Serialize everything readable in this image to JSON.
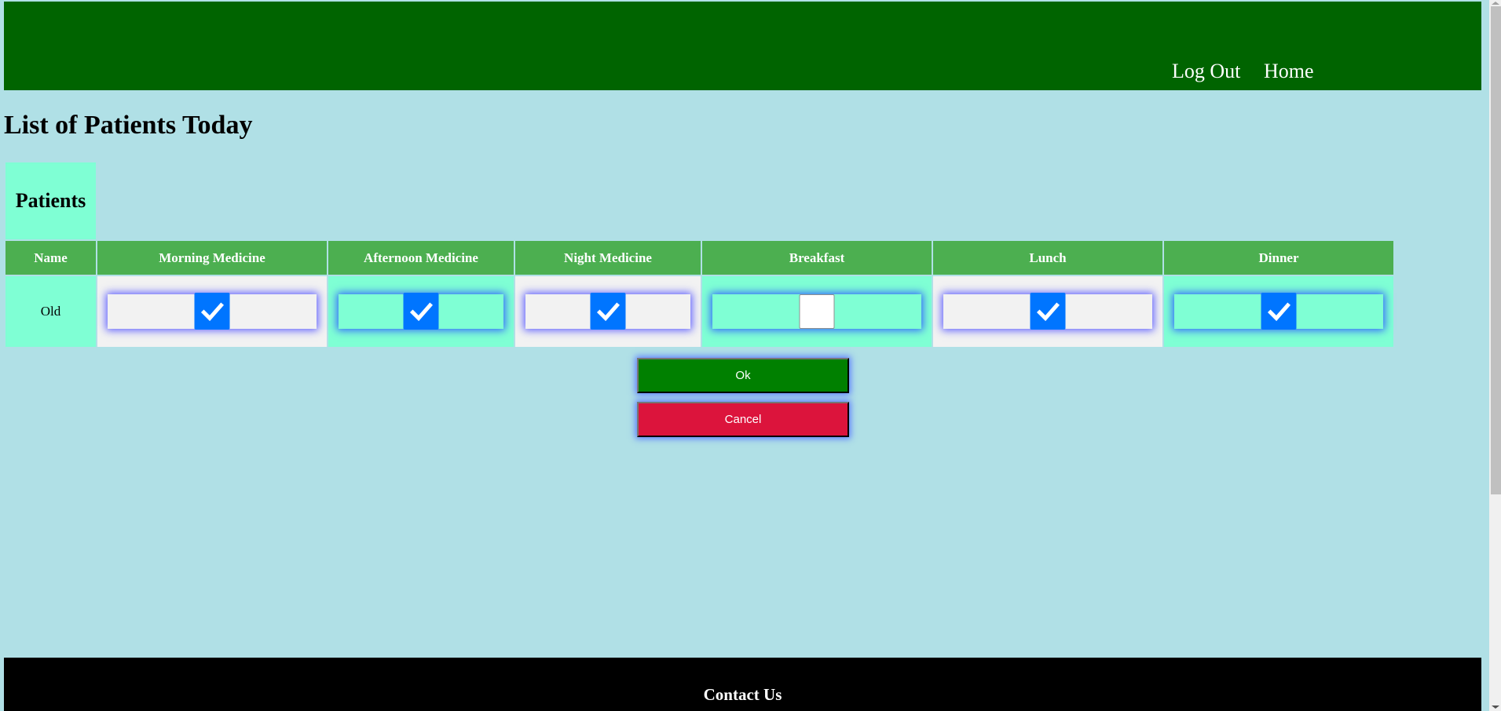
{
  "header": {
    "nav": [
      {
        "label": "Log Out"
      },
      {
        "label": "Home"
      }
    ]
  },
  "page_title": "List of Patients Today",
  "table": {
    "caption": "Patients",
    "columns": [
      "Name",
      "Morning Medicine",
      "Afternoon Medicine",
      "Night Medicine",
      "Breakfast",
      "Lunch",
      "Dinner"
    ],
    "rows": [
      {
        "name": "Old",
        "checks": [
          true,
          true,
          true,
          false,
          true,
          true
        ]
      }
    ]
  },
  "buttons": {
    "ok": "Ok",
    "cancel": "Cancel"
  },
  "footer": {
    "title": "Contact Us"
  },
  "colors": {
    "header_bg": "#006400",
    "page_bg": "#b0e0e6",
    "table_header_bg": "#4caf50",
    "cell_aqua": "#7fffd4",
    "cell_grey": "#f2f2f2",
    "checkbox_checked": "#0075ff",
    "ok_button": "#008000",
    "cancel_button": "#dc143c",
    "footer_bg": "#000000"
  }
}
